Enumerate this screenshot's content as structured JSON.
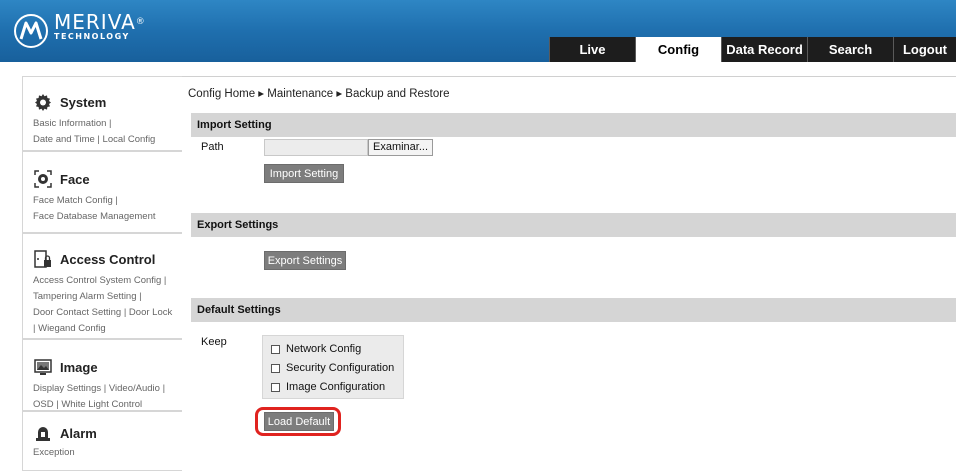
{
  "header": {
    "brand_name": "MERIVA",
    "brand_reg": "®",
    "brand_sub": "TECHNOLOGY",
    "tabs": [
      "Live",
      "Config",
      "Data Record",
      "Search",
      "Logout"
    ],
    "active_tab": "Config"
  },
  "sidebar": {
    "sections": [
      {
        "title": "System",
        "icon": "gear-icon",
        "links": [
          "Basic Information |",
          "Date and Time | Local Config"
        ]
      },
      {
        "title": "Face",
        "icon": "face-scan-icon",
        "links": [
          "Face Match Config |",
          "Face Database Management"
        ]
      },
      {
        "title": "Access Control",
        "icon": "door-lock-icon",
        "links": [
          "Access Control System Config |",
          "Tampering Alarm Setting |",
          "Door Contact Setting | Door Lock",
          " | Wiegand Config"
        ]
      },
      {
        "title": "Image",
        "icon": "image-icon",
        "links": [
          "Display Settings | Video/Audio |",
          "OSD | White Light Control"
        ]
      },
      {
        "title": "Alarm",
        "icon": "alarm-icon",
        "links": [
          "Exception"
        ]
      }
    ]
  },
  "breadcrumb": "Config Home ▸ Maintenance ▸ Backup and Restore",
  "import": {
    "header": "Import Setting",
    "path_label": "Path",
    "browse_label": "Examinar...",
    "button": "Import Setting"
  },
  "export": {
    "header": "Export Settings",
    "button": "Export Settings"
  },
  "defaults": {
    "header": "Default Settings",
    "keep_label": "Keep",
    "options": [
      "Network Config",
      "Security Configuration",
      "Image Configuration"
    ],
    "button": "Load Default"
  },
  "colors": {
    "header_blue": "#1f6fae",
    "tab_dark": "#1d1d1d",
    "button_gray": "#7d7d7d",
    "highlight_red": "#e0231f"
  }
}
